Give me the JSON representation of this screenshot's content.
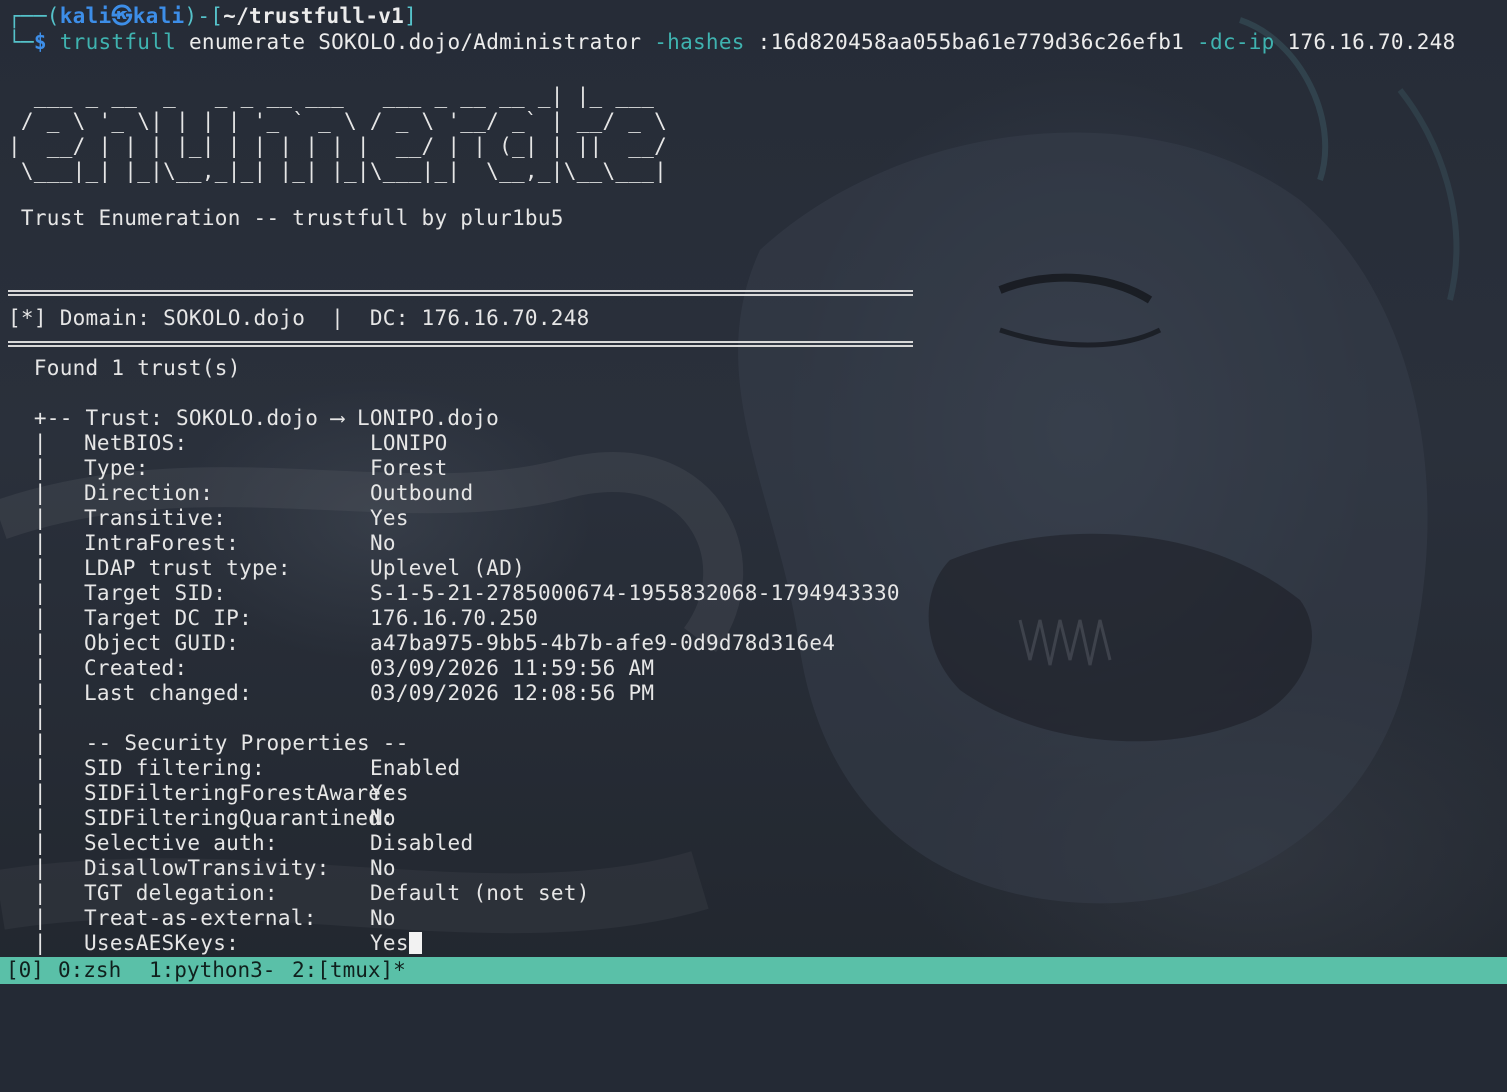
{
  "prompt": {
    "corner_top": "┌──(",
    "user": "kali",
    "at_symbol": "㉿",
    "host": "kali",
    "mid": ")-[",
    "cwd": "~/trustfull-v1",
    "close": "]",
    "corner_bottom": "└─",
    "dollar": "$",
    "command": "trustfull",
    "args1": "enumerate SOKOLO.dojo/Administrator",
    "flag_hashes": "-hashes",
    "hash": ":16d820458aa055ba61e779d36c26efb1",
    "flag_dcip": "-dc-ip",
    "ip": "176.16.70.248"
  },
  "banner": {
    "ascii_lines": [
      "  ___ _ __  _   _ _ __ ___   ___ _ __ __ _| |_ ___",
      " / _ \\ '_ \\| | | | '_ ` _ \\ / _ \\ '__/ _` | __/ _ \\",
      "|  __/ | | | |_| | | | | | |  __/ | | (_| | ||  __/",
      " \\___|_| |_|\\__,_|_| |_| |_|\\___|_|  \\__,_|\\__\\___|"
    ],
    "subtitle": " Trust Enumeration -- trustfull by plur1bu5"
  },
  "summary": {
    "domain_line": "[*] Domain: SOKOLO.dojo  |  DC: 176.16.70.248",
    "found": "  Found 1 trust(s)"
  },
  "trust": {
    "header_prefix": "  +-- Trust: SOKOLO.dojo ",
    "arrow": "⟶",
    "header_suffix": " LONIPO.dojo",
    "pipe": "  |",
    "fields": [
      {
        "key": "NetBIOS:",
        "value": "LONIPO"
      },
      {
        "key": "Type:",
        "value": "Forest"
      },
      {
        "key": "Direction:",
        "value": "Outbound"
      },
      {
        "key": "Transitive:",
        "value": "Yes"
      },
      {
        "key": "IntraForest:",
        "value": "No"
      },
      {
        "key": "LDAP trust type:",
        "value": "Uplevel (AD)"
      },
      {
        "key": "Target SID:",
        "value": "S-1-5-21-2785000674-1955832068-1794943330"
      },
      {
        "key": "Target DC IP:",
        "value": "176.16.70.250"
      },
      {
        "key": "Object GUID:",
        "value": "a47ba975-9bb5-4b7b-afe9-0d9d78d316e4"
      },
      {
        "key": "Created:",
        "value": "03/09/2026 11:59:56 AM"
      },
      {
        "key": "Last changed:",
        "value": "03/09/2026 12:08:56 PM"
      }
    ],
    "security_header": "-- Security Properties --",
    "security_fields": [
      {
        "key": "SID filtering:",
        "value": "Enabled"
      },
      {
        "key": "SIDFilteringForestAware:",
        "value": "Yes"
      },
      {
        "key": "SIDFilteringQuarantined:",
        "value": "No"
      },
      {
        "key": "Selective auth:",
        "value": "Disabled"
      },
      {
        "key": "DisallowTransivity:",
        "value": "No"
      },
      {
        "key": "TGT delegation:",
        "value": "Default (not set)"
      },
      {
        "key": "Treat-as-external:",
        "value": "No"
      },
      {
        "key": "UsesAESKeys:",
        "value": "Yes"
      }
    ]
  },
  "tmux": {
    "session": "[0]",
    "window0": "0:zsh",
    "window1": "1:python3-",
    "window2": "2:[tmux]*"
  }
}
